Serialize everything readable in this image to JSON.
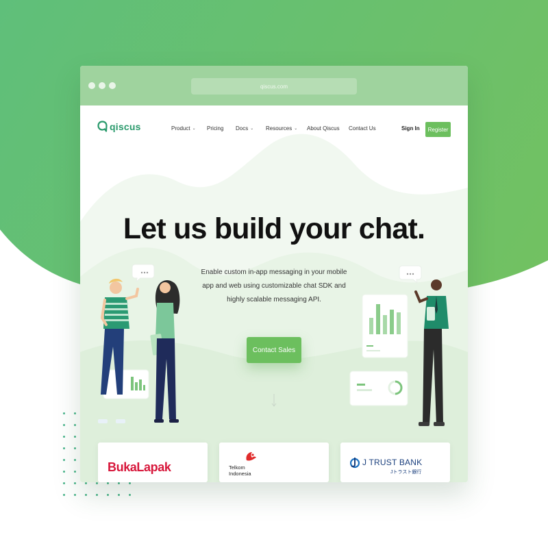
{
  "browser": {
    "url": "qiscus.com"
  },
  "nav": {
    "logo_text": "qiscus",
    "items": [
      {
        "label": "Product",
        "has_dropdown": true
      },
      {
        "label": "Pricing",
        "has_dropdown": false
      },
      {
        "label": "Docs",
        "has_dropdown": true
      },
      {
        "label": "Resources",
        "has_dropdown": true
      },
      {
        "label": "About Qiscus",
        "has_dropdown": false
      },
      {
        "label": "Contact Us",
        "has_dropdown": false
      }
    ],
    "signin_label": "Sign In",
    "register_label": "Register"
  },
  "hero": {
    "title": "Let us build your chat.",
    "subtitle": "Enable custom in-app messaging in your mobile app and web using customizable chat SDK and highly scalable messaging API.",
    "cta_label": "Contact Sales"
  },
  "clients": {
    "bukalapak": "BukaLapak",
    "telkom_line1": "Telkom",
    "telkom_line2": "Indonesia",
    "jtrust_main": "J TRUST BANK",
    "jtrust_sub": "Jトラスト銀行"
  },
  "colors": {
    "brand_green": "#6cbf5e",
    "logo_green": "#2a9a6c",
    "chrome_green": "#9fd39e"
  }
}
